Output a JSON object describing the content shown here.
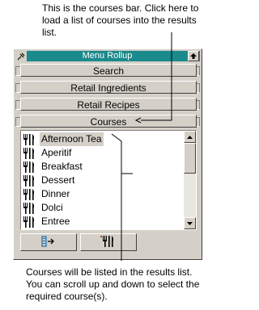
{
  "callouts": {
    "top": "This is the courses bar.  Click here to load a list of courses into the results list.",
    "bottom": "Courses will be listed in the results list.  You can scroll up and down to select the required course(s)."
  },
  "panel": {
    "title": "Menu Rollup",
    "bars": [
      {
        "label": "Search"
      },
      {
        "label": "Retail Ingredients"
      },
      {
        "label": "Retail Recipes"
      },
      {
        "label": "Courses"
      }
    ],
    "courses": [
      {
        "label": "Afternoon Tea",
        "selected": true
      },
      {
        "label": "Aperitif"
      },
      {
        "label": "Breakfast"
      },
      {
        "label": "Dessert"
      },
      {
        "label": "Dinner"
      },
      {
        "label": "Dolci"
      },
      {
        "label": "Entree"
      }
    ],
    "colors": {
      "titlebar": "#1a8a8c",
      "panel": "#d4d0c8",
      "callout_line": "#000000"
    },
    "icons": [
      "pin-icon",
      "up-arrow-icon",
      "cutlery-icon",
      "list-transfer-icon",
      "cutlery-button-icon"
    ]
  }
}
